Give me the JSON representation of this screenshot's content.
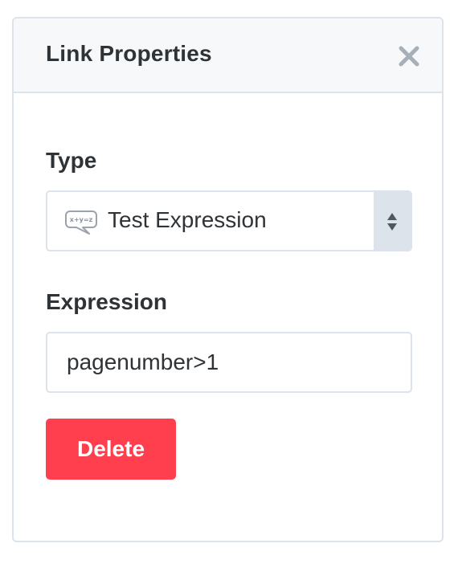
{
  "panel": {
    "title": "Link Properties",
    "close_icon": "close-icon"
  },
  "type_field": {
    "label": "Type",
    "selected": "Test Expression",
    "icon": "expression-bubble-icon",
    "icon_text": "x+y=z"
  },
  "expression_field": {
    "label": "Expression",
    "value": "pagenumber>1"
  },
  "actions": {
    "delete_label": "Delete"
  },
  "colors": {
    "danger": "#ff3f4d",
    "border": "#dde3ea",
    "header_bg": "#f6f8fa",
    "text": "#2e3338"
  }
}
